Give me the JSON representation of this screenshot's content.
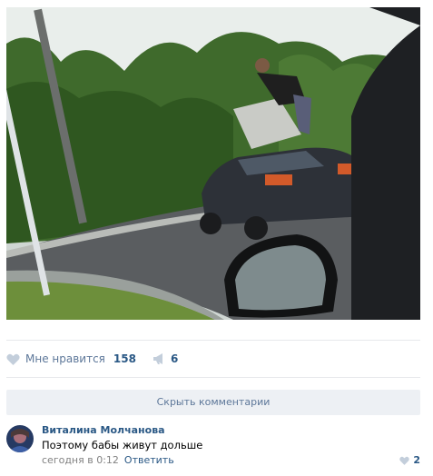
{
  "post": {
    "likes_label": "Мне нравится",
    "likes_count": "158",
    "shares_count": "6"
  },
  "comments_section": {
    "hide_button_label": "Скрыть комментарии"
  },
  "comment": {
    "author": "Виталина Молчанова",
    "text": "Поэтому бабы живут дольше",
    "time": "сегодня в 0:12",
    "reply_label": "Ответить",
    "likes_count": "2"
  },
  "colors": {
    "link_blue": "#2a5885",
    "muted_blue": "#5d7799",
    "button_bg": "#edf0f4",
    "divider": "#e7e8ec",
    "meta_gray": "#828282"
  },
  "icons": {
    "like": "heart-icon",
    "share": "megaphone-icon",
    "comment_like": "heart-icon"
  }
}
